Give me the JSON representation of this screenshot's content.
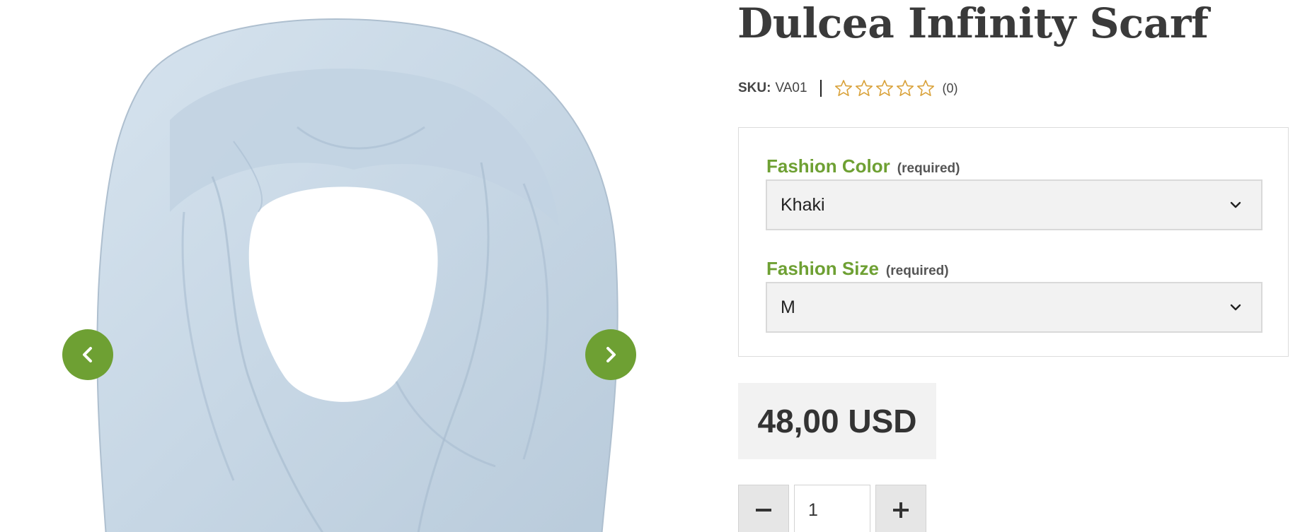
{
  "product": {
    "title": "Dulcea Infinity Scarf",
    "sku_label": "SKU:",
    "sku_value": "VA01",
    "rating": 0,
    "rating_max": 5,
    "review_count": "(0)"
  },
  "gallery": {
    "prev_icon": "chevron-left-icon",
    "next_icon": "chevron-right-icon",
    "image_subject": "light blue infinity scarf"
  },
  "options": {
    "color": {
      "label": "Fashion Color",
      "required_text": "(required)",
      "selected": "Khaki"
    },
    "size": {
      "label": "Fashion Size",
      "required_text": "(required)",
      "selected": "M"
    }
  },
  "price": {
    "display": "48,00 USD"
  },
  "quantity": {
    "value": "1",
    "minus_icon": "minus-icon",
    "plus_icon": "plus-icon"
  },
  "colors": {
    "accent_green": "#6ea033",
    "title_text": "#3a3a3a",
    "star_outline": "#d9a23a",
    "scarf": "#c8d8e6"
  }
}
